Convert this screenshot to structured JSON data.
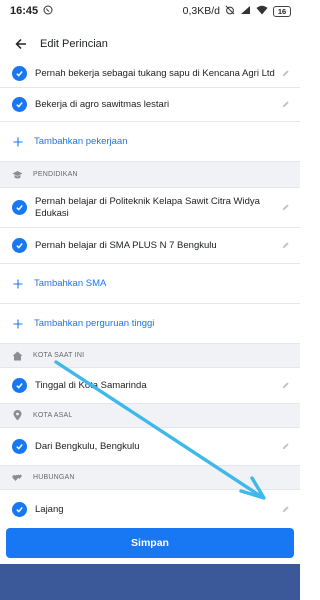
{
  "status_bar": {
    "time": "16:45",
    "net_speed": "0,3KB/d",
    "battery": "16"
  },
  "header": {
    "title": "Edit Perincian"
  },
  "work": {
    "items": [
      {
        "text": "Pernah bekerja sebagai  tukang sapu di Kencana Agri Ltd"
      },
      {
        "text": "Bekerja di agro sawitmas lestari"
      }
    ],
    "add_label": "Tambahkan pekerjaan"
  },
  "education": {
    "section_title": "PENDIDIKAN",
    "items": [
      {
        "text": "Pernah belajar di Politeknik Kelapa Sawit Citra Widya Edukasi"
      },
      {
        "text": "Pernah belajar di SMA PLUS N 7 Bengkulu"
      }
    ],
    "add_sma_label": "Tambahkan SMA",
    "add_college_label": "Tambahkan perguruan tinggi"
  },
  "current_city": {
    "section_title": "KOTA SAAT INI",
    "text": "Tinggal di Kota Samarinda"
  },
  "hometown": {
    "section_title": "KOTA ASAL",
    "text": "Dari Bengkulu, Bengkulu"
  },
  "relationship": {
    "section_title": "HUBUNGAN",
    "text": "Lajang"
  },
  "footer": {
    "save_label": "Simpan"
  },
  "colors": {
    "accent": "#1877f2",
    "annotation_arrow": "#3fb8ec",
    "navbar": "#3b5998"
  }
}
